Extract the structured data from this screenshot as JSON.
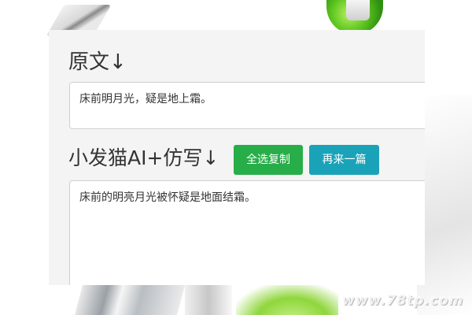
{
  "original": {
    "heading": "原文↓",
    "text": "床前明月光，疑是地上霜。"
  },
  "rewrite": {
    "heading": "小发猫AI+仿写↓",
    "text": "床前的明亮月光被怀疑是地面结霜。",
    "copy_all_label": "全选复制",
    "regenerate_label": "再来一篇"
  },
  "watermark": "www.78tp.com",
  "colors": {
    "copy_button": "#27ae48",
    "regenerate_button": "#1aa3b8",
    "panel_background": "#f4f4f4",
    "text": "#333333"
  }
}
